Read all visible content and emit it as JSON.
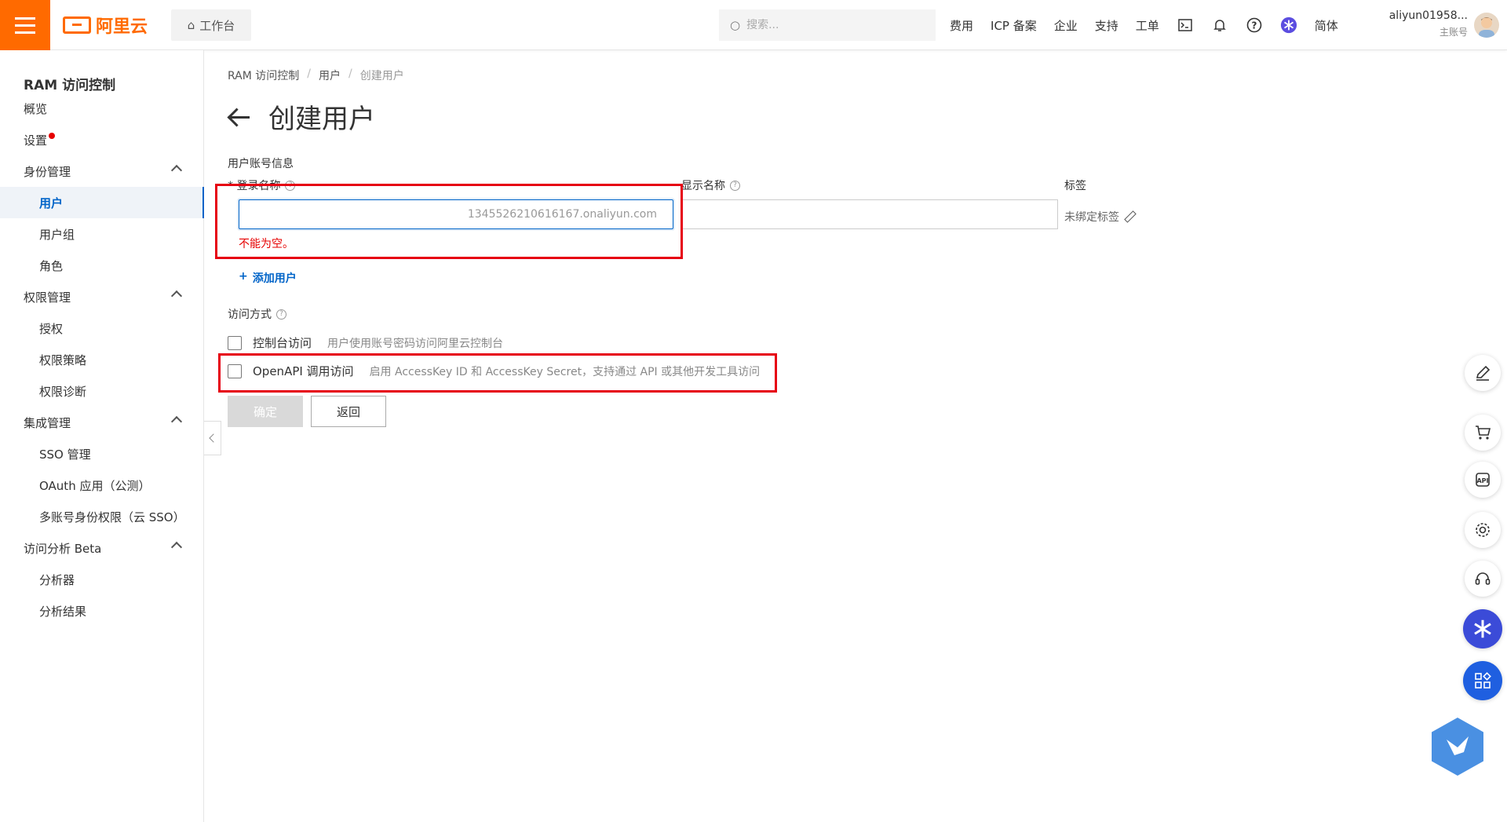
{
  "topbar": {
    "logo_text": "阿里云",
    "workbench_label": "工作台",
    "search_placeholder": "搜索...",
    "nav": [
      "费用",
      "ICP 备案",
      "企业",
      "支持",
      "工单"
    ],
    "lang_label": "简体",
    "account_name": "aliyun01958...",
    "account_sub": "主账号"
  },
  "sidebar": {
    "title": "RAM 访问控制",
    "items": [
      {
        "label": "概览",
        "type": "group"
      },
      {
        "label": "设置",
        "type": "group",
        "dot": true
      },
      {
        "label": "身份管理",
        "type": "group",
        "expandable": true
      },
      {
        "label": "用户",
        "type": "child",
        "active": true
      },
      {
        "label": "用户组",
        "type": "child"
      },
      {
        "label": "角色",
        "type": "child"
      },
      {
        "label": "权限管理",
        "type": "group",
        "expandable": true
      },
      {
        "label": "授权",
        "type": "child"
      },
      {
        "label": "权限策略",
        "type": "child"
      },
      {
        "label": "权限诊断",
        "type": "child"
      },
      {
        "label": "集成管理",
        "type": "group",
        "expandable": true
      },
      {
        "label": "SSO 管理",
        "type": "child"
      },
      {
        "label": "OAuth 应用（公测）",
        "type": "child"
      },
      {
        "label": "多账号身份权限（云 SSO）",
        "type": "child"
      },
      {
        "label": "访问分析 Beta",
        "type": "group",
        "expandable": true
      },
      {
        "label": "分析器",
        "type": "child"
      },
      {
        "label": "分析结果",
        "type": "child"
      }
    ]
  },
  "breadcrumb": [
    "RAM 访问控制",
    "用户",
    "创建用户"
  ],
  "page_title": "创建用户",
  "form": {
    "section_account": "用户账号信息",
    "login_label": "* 登录名称",
    "login_value": "",
    "login_suffix": "@1345526210616167.onaliyun.com",
    "login_error": "不能为空。",
    "display_label": "显示名称",
    "display_value": "",
    "tag_label": "标签",
    "tag_link": "未绑定标签",
    "add_user": "添加用户",
    "section_access": "访问方式",
    "console_label": "控制台访问",
    "console_desc": "用户使用账号密码访问阿里云控制台",
    "openapi_label": "OpenAPI 调用访问",
    "openapi_desc": "启用 AccessKey ID 和 AccessKey Secret，支持通过 API 或其他开发工具访问",
    "confirm_label": "确定",
    "back_label": "返回"
  },
  "colors": {
    "brand": "#ff6a00",
    "primary": "#0064c8",
    "error": "#e60000",
    "highlight_box": "#e60012"
  }
}
